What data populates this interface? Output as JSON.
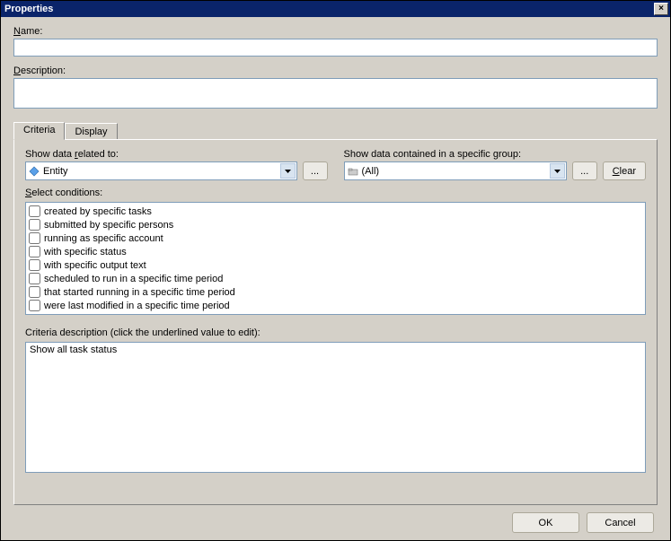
{
  "window": {
    "title": "Properties",
    "close_symbol": "×"
  },
  "labels": {
    "name": "Name:",
    "name_underline": "N",
    "description": "Description:",
    "description_underline": "D"
  },
  "fields": {
    "name_value": "",
    "description_value": ""
  },
  "tabs": [
    {
      "label": "Criteria",
      "active": true
    },
    {
      "label": "Display",
      "active": false
    }
  ],
  "criteria": {
    "related_label": "Show data related to:",
    "related_underline_prefix": "Show data ",
    "related_underline_char": "r",
    "related_underline_suffix": "elated to:",
    "related_value": "Entity",
    "group_label": "Show data contained in a specific group:",
    "group_underline_prefix": "Show data contained in a specific ",
    "group_underline_char": "g",
    "group_underline_suffix": "roup:",
    "group_value": "(All)",
    "clear_label": "Clear",
    "browse_label": "...",
    "select_label": "Select conditions:",
    "select_underline_char": "S",
    "select_underline_suffix": "elect conditions:",
    "conditions": [
      "created by specific tasks",
      "submitted by specific persons",
      "running as specific account",
      "with specific status",
      "with specific output text",
      "scheduled to run in a specific time period",
      "that started running in a specific time period",
      "were last modified in a specific time period"
    ],
    "desc_label": "Criteria description (click the underlined value to edit):",
    "desc_value": "Show all task status"
  },
  "buttons": {
    "ok": "OK",
    "cancel": "Cancel"
  }
}
